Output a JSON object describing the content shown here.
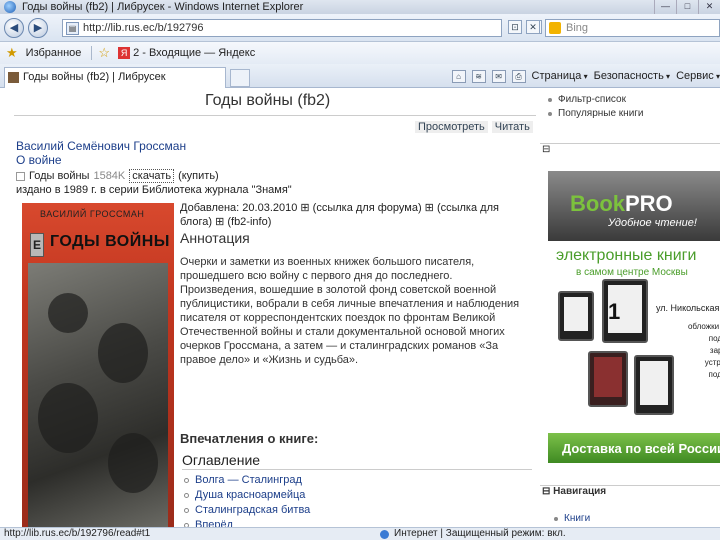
{
  "window": {
    "title": "Годы войны (fb2) | Либрусек - Windows Internet Explorer",
    "buttons": [
      "—",
      "□",
      "✕"
    ]
  },
  "address": {
    "url": "http://lib.rus.ec/b/192796",
    "search_placeholder": "Bing"
  },
  "favorites": {
    "label": "Избранное",
    "items": [
      {
        "label": "2 - Входящие — Яндекс",
        "icon": "yandex-icon"
      }
    ]
  },
  "tab": {
    "label": "Годы войны (fb2) | Либрусек"
  },
  "commands": {
    "page_menu": "Страница",
    "safety_menu": "Безопасность",
    "service_menu": "Сервис"
  },
  "book": {
    "page_title": "Годы войны (fb2)",
    "view_link": "Просмотреть",
    "read_link": "Читать",
    "author": "Василий Семёнович Гроссман",
    "subtitle": "О войне",
    "file_title": "Годы войны",
    "file_size": "1584K",
    "download": "скачать",
    "buy": "(купить)",
    "publication": "издано в 1989 г. в серии Библиотека журнала \"Знамя\"",
    "added": "Добавлена: 20.03.2010 ⊞ (ссылка для форума) ⊞ (ссылка для блога) ⊞ (fb2-info)",
    "cover_author": "ВАСИЛИЙ ГРОССМАН",
    "cover_badge": "Е",
    "cover_title": "ГОДЫ ВОЙНЫ",
    "annotation_title": "Аннотация",
    "annotation_text": "Очерки и заметки из военных книжек большого писателя, прошедшего всю войну с первого дня до последнего. Произведения, вошедшие в золотой фонд советской военной публицистики, вобрали в себя личные впечатления и наблюдения писателя от корреспондентских поездок по фронтам Великой Отечественной войны и стали документальной основой многих очерков Гроссмана, а затем — и сталинградских романов «За правое дело» и «Жизнь и судьба».",
    "impressions_title": "Впечатления о книге:",
    "toc_title": "Оглавление",
    "toc": [
      "Волга — Сталинград",
      "Душа красноармейца",
      "Сталинградская битва",
      "Вперёд"
    ]
  },
  "sidebar": {
    "links": [
      "Фильтр-список",
      "Популярные книги"
    ],
    "box_label": "⊟",
    "banner": {
      "brand_a": "Book",
      "brand_b": "PRO",
      "slogan": "Удобное чтение!",
      "line1": "электронные книги",
      "line2": "в самом центре Москвы",
      "number": "1",
      "address": "ул. Никольская,",
      "desc": "обложки лампы подсветки зарядные устройства подставки",
      "delivery": "Доставка по всей России"
    },
    "nav_title": "⊟ Навигация",
    "nav_item": "Книги"
  },
  "status": {
    "left": "http://lib.rus.ec/b/192796/read#t1",
    "right": "Интернет | Защищенный режим: вкл."
  }
}
